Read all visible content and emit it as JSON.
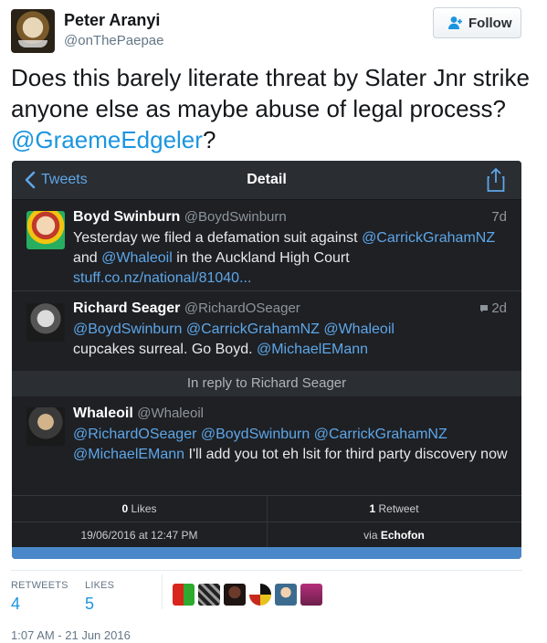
{
  "header": {
    "display_name": "Peter Aranyi",
    "handle": "@onThePaepae",
    "follow_label": "Follow"
  },
  "tweet": {
    "text": "Does this barely literate threat by Slater Jnr strike anyone else as maybe abuse of legal process?",
    "mention": "@GraemeEdgeler",
    "trailing": "?"
  },
  "embedded_screenshot": {
    "nav": {
      "back_label": "Tweets",
      "title": "Detail"
    },
    "tweets": [
      {
        "name": "Boyd Swinburn",
        "handle": "@BoydSwinburn",
        "time": "7d",
        "text_1": "Yesterday we filed a defamation suit against",
        "mention_1": "@CarrickGrahamNZ",
        "text_2": " and ",
        "mention_2": "@Whaleoil",
        "text_3": " in the Auckland High Court ",
        "link": "stuff.co.nz/national/81040..."
      },
      {
        "name": "Richard Seager",
        "handle": "@RichardOSeager",
        "time": "2d",
        "mentions": "@BoydSwinburn @CarrickGrahamNZ @Whaleoil",
        "text": "cupcakes surreal. Go Boyd. ",
        "mention_end": "@MichaelEMann"
      },
      {
        "name": "Whaleoil",
        "handle": "@Whaleoil",
        "mentions_1": "@RichardOSeager @BoydSwinburn @CarrickGrahamNZ",
        "mention_2": "@MichaelEMann",
        "text": " I'll add you tot eh lsit for third party discovery now"
      }
    ],
    "reply_bar": "In reply to Richard Seager",
    "stats": {
      "likes_count": "0",
      "likes_label": "Likes",
      "retweets_count": "1",
      "retweets_label": "Retweet",
      "date": "19/06/2016 at 12:47 PM",
      "via_label": "via",
      "via_app": "Echofon"
    }
  },
  "counts": {
    "retweets_label": "RETWEETS",
    "retweets_value": "4",
    "likes_label": "LIKES",
    "likes_value": "5"
  },
  "timestamp": "1:07 AM - 21 Jun 2016",
  "colors": {
    "accent": "#1b95e0",
    "embedded_background": "#1e2024",
    "embedded_link": "#5ea6e8"
  }
}
